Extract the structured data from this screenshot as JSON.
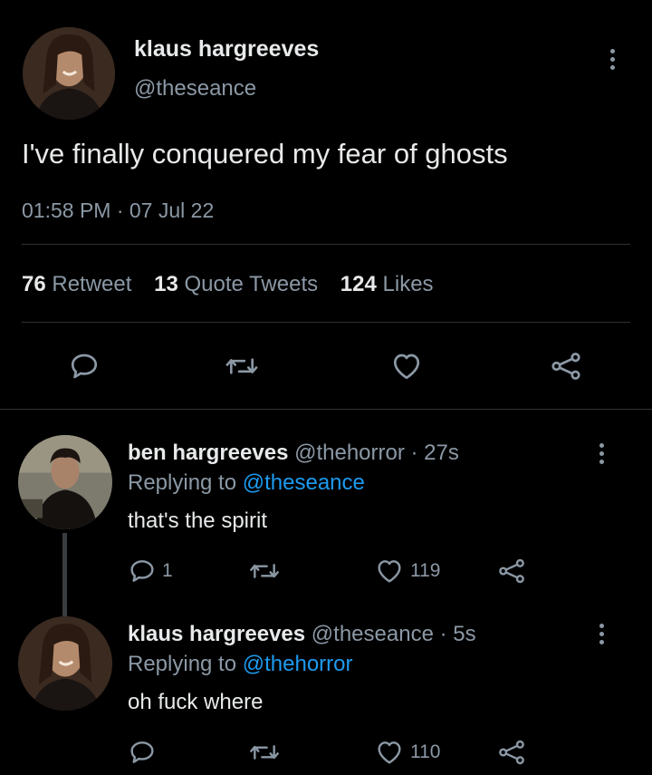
{
  "main_tweet": {
    "author_name": "klaus hargreeves",
    "author_handle": "@theseance",
    "text": "I've finally conquered my fear of ghosts",
    "timestamp": "01:58 PM · 07 Jul 22",
    "stats": {
      "retweets_count": "76",
      "retweets_label": "Retweet",
      "quotes_count": "13",
      "quotes_label": "Quote Tweets",
      "likes_count": "124",
      "likes_label": "Likes"
    }
  },
  "replies": [
    {
      "author_name": "ben hargreeves",
      "author_handle": "@thehorror",
      "age": "· 27s",
      "replying_label": "Replying to",
      "replying_to": "@theseance",
      "text": "that's the spirit",
      "reply_count": "1",
      "retweet_count": "",
      "like_count": "119"
    },
    {
      "author_name": "klaus hargreeves",
      "author_handle": "@theseance",
      "age": "· 5s",
      "replying_label": "Replying to",
      "replying_to": "@thehorror",
      "text": "oh fuck where",
      "reply_count": "",
      "retweet_count": "",
      "like_count": "110"
    }
  ],
  "icons": {
    "reply": "speech-bubble-icon",
    "retweet": "retweet-arrows-icon",
    "like": "heart-icon",
    "share": "share-nodes-icon",
    "more": "vertical-dots-icon"
  },
  "colors": {
    "background": "#000000",
    "text_primary": "#e7e9ea",
    "text_secondary": "#8b98a5",
    "link": "#1d9bf0",
    "divider": "#2f3336"
  }
}
